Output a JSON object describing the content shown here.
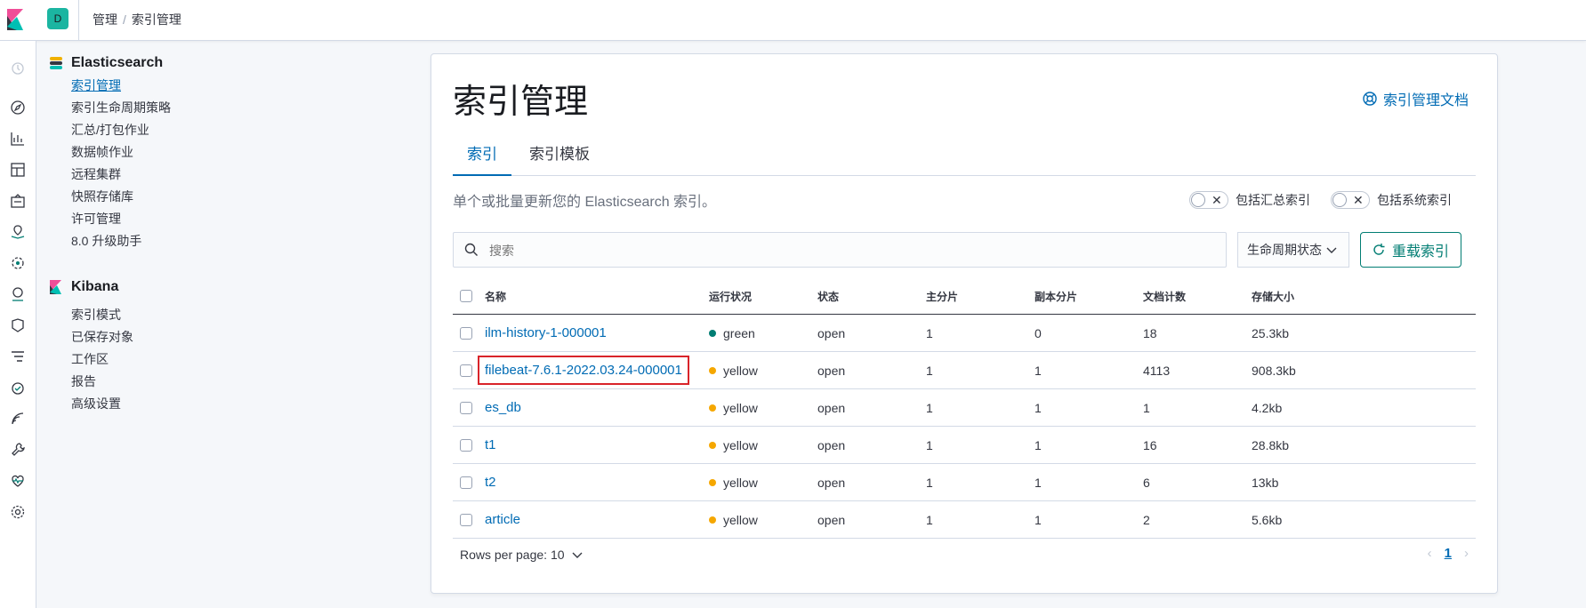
{
  "header": {
    "space_initial": "D",
    "breadcrumb": [
      "管理",
      "索引管理"
    ],
    "separator": "/"
  },
  "nav_icons": [
    "clock-icon",
    "compass-icon",
    "visualize-icon",
    "dashboard-icon",
    "canvas-icon",
    "maps-icon",
    "ml-icon",
    "infrastructure-icon",
    "logs-icon",
    "apm-icon",
    "uptime-icon",
    "siem-icon",
    "dev-tools-icon",
    "monitoring-icon",
    "management-icon"
  ],
  "sidebar": {
    "groups": [
      {
        "title": "Elasticsearch",
        "items": [
          "索引管理",
          "索引生命周期策略",
          "汇总/打包作业",
          "数据帧作业",
          "远程集群",
          "快照存储库",
          "许可管理",
          "8.0 升级助手"
        ]
      },
      {
        "title": "Kibana",
        "items": [
          "索引模式",
          "已保存对象",
          "工作区",
          "报告",
          "高级设置"
        ]
      }
    ]
  },
  "main": {
    "title": "索引管理",
    "doc_link": "索引管理文档",
    "tabs": [
      "索引",
      "索引模板"
    ],
    "description": "单个或批量更新您的 Elasticsearch 索引。",
    "toggles": [
      "包括汇总索引",
      "包括系统索引"
    ],
    "search_placeholder": "搜索",
    "lifecycle_filter": "生命周期状态",
    "reload_button": "重载索引",
    "columns": [
      "名称",
      "运行状况",
      "状态",
      "主分片",
      "副本分片",
      "文档计数",
      "存储大小"
    ],
    "rows": [
      {
        "name": "ilm-history-1-000001",
        "health": "green",
        "status": "open",
        "primary": "1",
        "replica": "0",
        "docs": "18",
        "size": "25.3kb"
      },
      {
        "name": "filebeat-7.6.1-2022.03.24-000001",
        "health": "yellow",
        "status": "open",
        "primary": "1",
        "replica": "1",
        "docs": "4113",
        "size": "908.3kb"
      },
      {
        "name": "es_db",
        "health": "yellow",
        "status": "open",
        "primary": "1",
        "replica": "1",
        "docs": "1",
        "size": "4.2kb"
      },
      {
        "name": "t1",
        "health": "yellow",
        "status": "open",
        "primary": "1",
        "replica": "1",
        "docs": "16",
        "size": "28.8kb"
      },
      {
        "name": "t2",
        "health": "yellow",
        "status": "open",
        "primary": "1",
        "replica": "1",
        "docs": "6",
        "size": "13kb"
      },
      {
        "name": "article",
        "health": "yellow",
        "status": "open",
        "primary": "1",
        "replica": "1",
        "docs": "2",
        "size": "5.6kb"
      }
    ],
    "rows_per_page": "Rows per page: 10",
    "current_page": "1"
  },
  "colors": {
    "green": "#017d73",
    "yellow": "#f5a700",
    "link": "#006bb4",
    "highlight_box": "#d9242a"
  }
}
